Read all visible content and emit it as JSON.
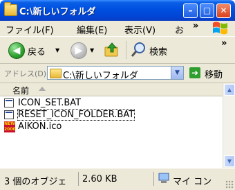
{
  "window": {
    "title": "C:\\新しいフォルダ",
    "minimize_glyph": "–",
    "maximize_glyph": "□",
    "close_glyph": "✕"
  },
  "menu": {
    "items": [
      "ファイル(F)",
      "編集(E)",
      "表示(V)",
      "お"
    ],
    "overflow": "»"
  },
  "toolbar": {
    "back_label": "戻る",
    "search_label": "検索",
    "overflow": "»"
  },
  "address": {
    "label": "アドレス(D)",
    "path": "C:\\新しいフォルダ",
    "go_label": "移動"
  },
  "content": {
    "column_header": "名前",
    "files": [
      {
        "name": "ICON_SET.BAT",
        "icon": "batch-file-icon"
      },
      {
        "name": "RESET_ICON_FOLDER.BAT",
        "icon": "batch-file-icon"
      },
      {
        "name": "AIKON.ico",
        "icon": "ico-file-icon"
      }
    ]
  },
  "status": {
    "objects": "3 個のオブジェ",
    "size": "2.60 KB",
    "location": "マイ コン"
  }
}
